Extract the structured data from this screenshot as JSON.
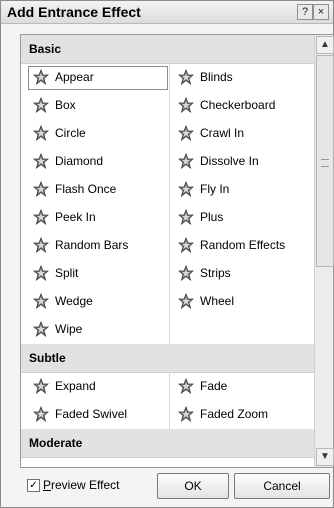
{
  "dialog": {
    "title": "Add Entrance Effect",
    "help_glyph": "?",
    "close_glyph": "×"
  },
  "categories": [
    {
      "name": "Basic",
      "items": [
        {
          "label": "Appear",
          "icon": "star-effect-icon",
          "selected": true
        },
        {
          "label": "Blinds",
          "icon": "star-effect-icon"
        },
        {
          "label": "Box",
          "icon": "star-effect-icon"
        },
        {
          "label": "Checkerboard",
          "icon": "star-effect-icon"
        },
        {
          "label": "Circle",
          "icon": "star-effect-icon"
        },
        {
          "label": "Crawl In",
          "icon": "star-effect-icon"
        },
        {
          "label": "Diamond",
          "icon": "star-effect-icon"
        },
        {
          "label": "Dissolve In",
          "icon": "star-effect-icon"
        },
        {
          "label": "Flash Once",
          "icon": "star-effect-icon"
        },
        {
          "label": "Fly In",
          "icon": "star-effect-icon"
        },
        {
          "label": "Peek In",
          "icon": "star-effect-icon"
        },
        {
          "label": "Plus",
          "icon": "star-effect-icon"
        },
        {
          "label": "Random Bars",
          "icon": "star-effect-icon"
        },
        {
          "label": "Random Effects",
          "icon": "star-effect-icon"
        },
        {
          "label": "Split",
          "icon": "star-effect-icon"
        },
        {
          "label": "Strips",
          "icon": "star-effect-icon"
        },
        {
          "label": "Wedge",
          "icon": "star-effect-icon"
        },
        {
          "label": "Wheel",
          "icon": "star-effect-icon"
        },
        {
          "label": "Wipe",
          "icon": "star-effect-icon"
        }
      ]
    },
    {
      "name": "Subtle",
      "items": [
        {
          "label": "Expand",
          "icon": "star-effect-icon"
        },
        {
          "label": "Fade",
          "icon": "star-effect-icon"
        },
        {
          "label": "Faded Swivel",
          "icon": "star-effect-icon"
        },
        {
          "label": "Faded Zoom",
          "icon": "star-effect-icon"
        }
      ]
    },
    {
      "name": "Moderate",
      "items": []
    }
  ],
  "footer": {
    "preview_checked": true,
    "preview_label_accel": "P",
    "preview_label_rest": "review Effect",
    "ok_label": "OK",
    "cancel_label": "Cancel"
  },
  "scrollbar": {
    "up_glyph": "▲",
    "down_glyph": "▼"
  }
}
